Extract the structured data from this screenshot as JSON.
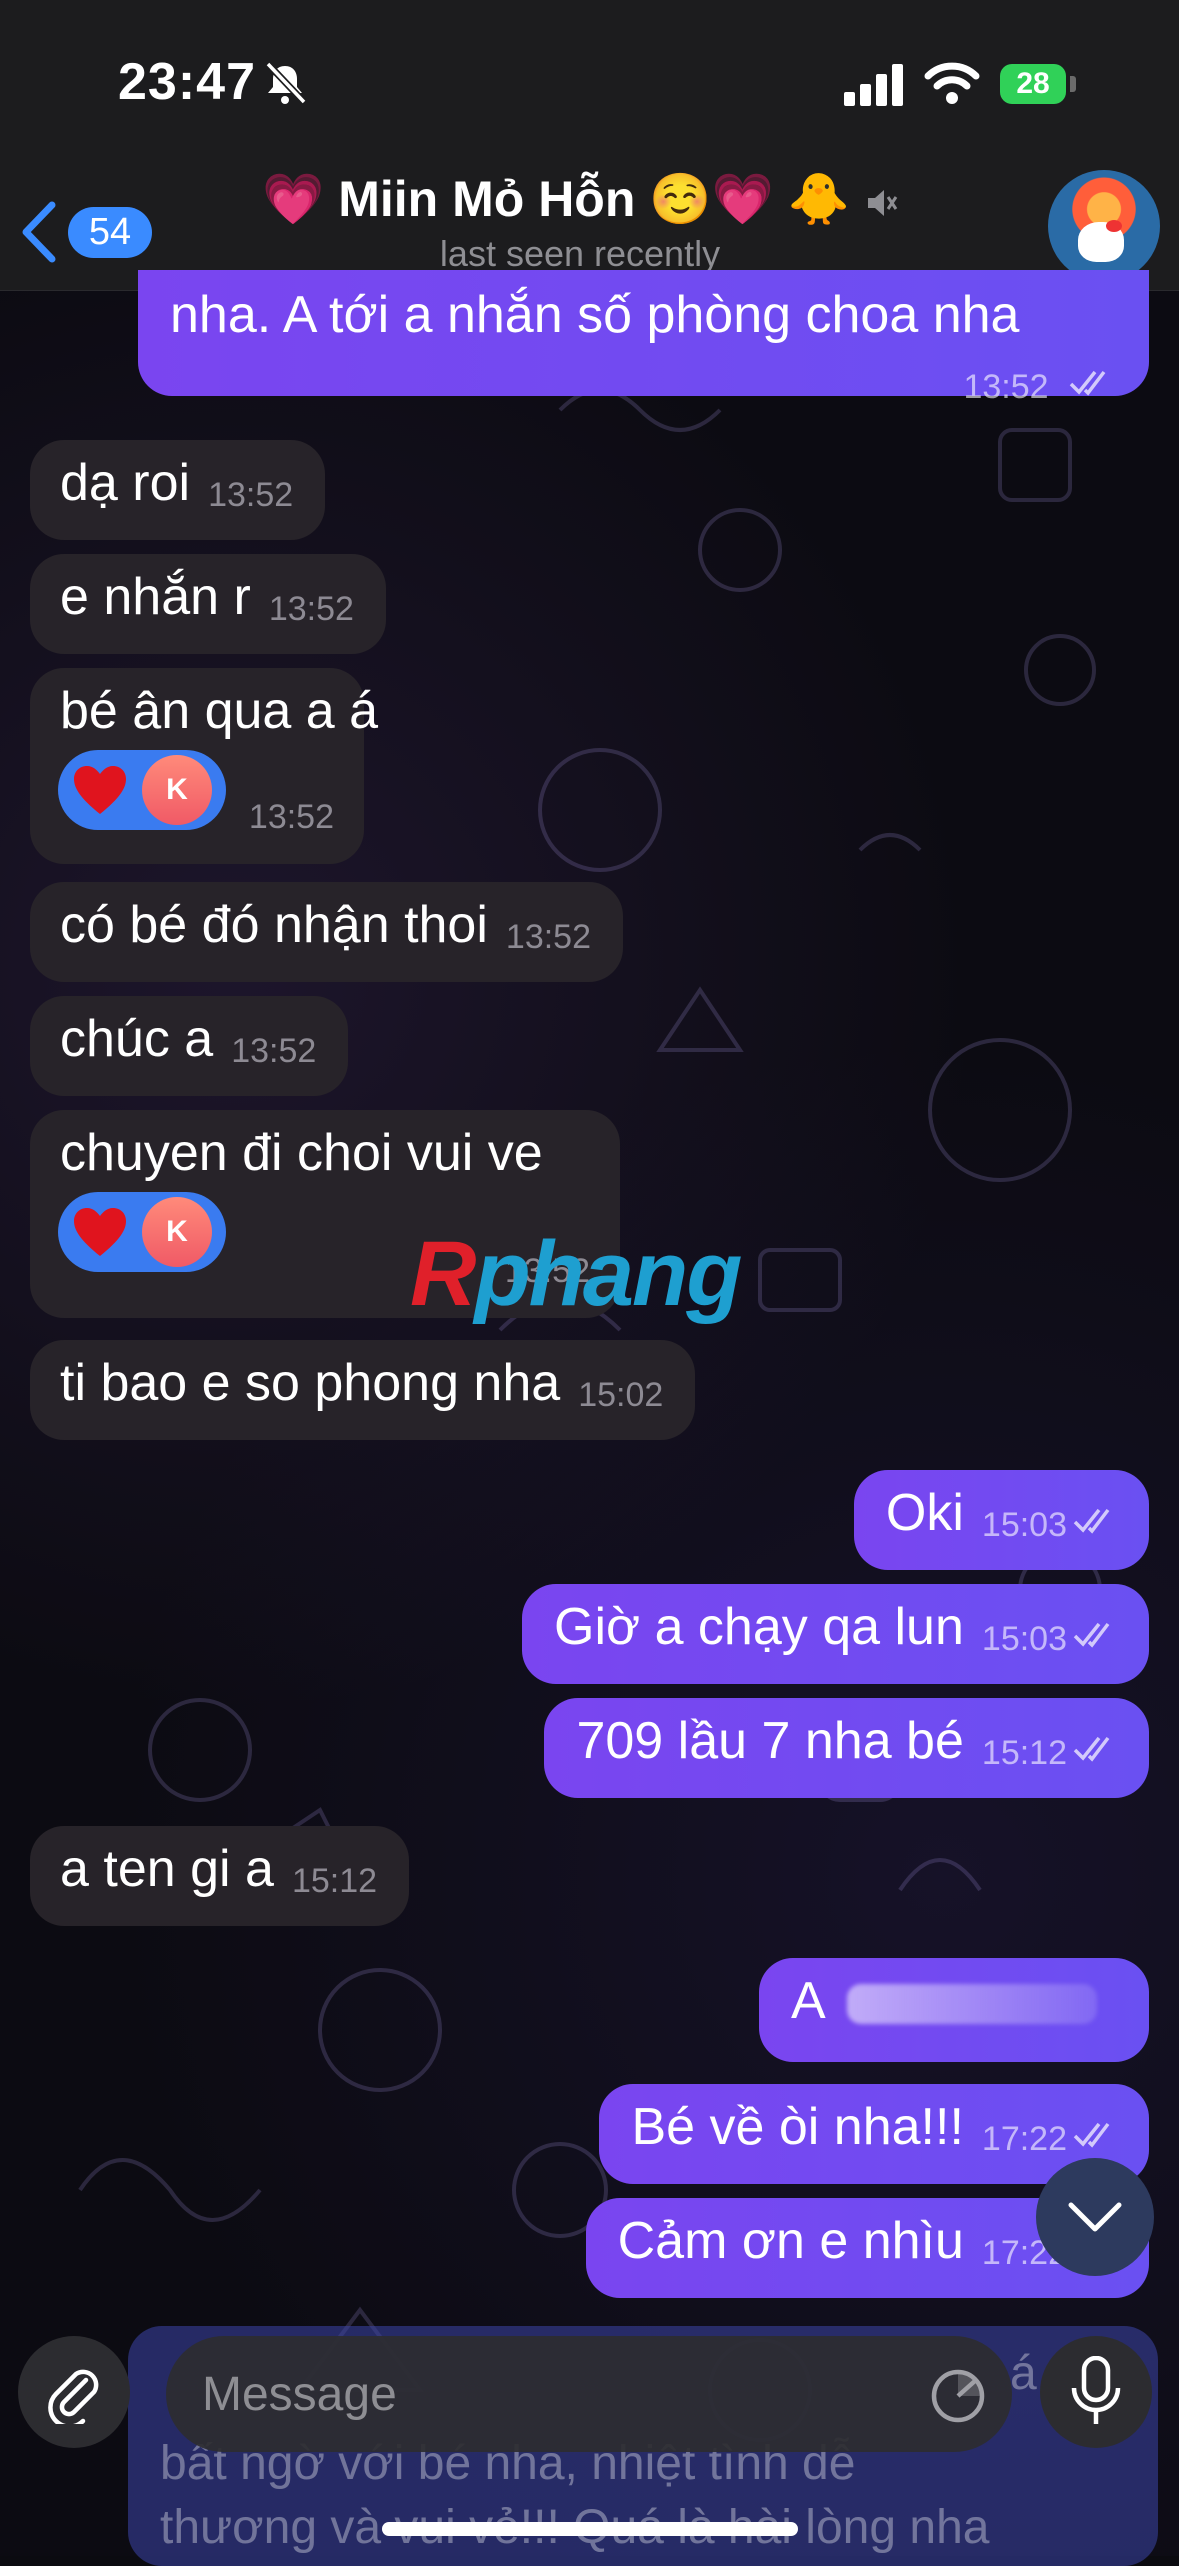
{
  "status": {
    "time": "23:47",
    "battery": "28"
  },
  "header": {
    "back_count": "54",
    "title_left_emoji": "💗",
    "title_name": "Miin Mỏ Hỗn",
    "title_right_emoji": "☺️💗",
    "title_extra_emoji": "🐥",
    "subtitle": "last seen recently"
  },
  "messages": [
    {
      "dir": "out",
      "text": "nha. A tới a nhắn số phòng choa nha",
      "time": "13:52"
    },
    {
      "dir": "in",
      "text": "dạ roi",
      "time": "13:52"
    },
    {
      "dir": "in",
      "text": "e nhắn r",
      "time": "13:52"
    },
    {
      "dir": "in",
      "text": "bé ân qua a á",
      "time": "13:52",
      "reaction": "K"
    },
    {
      "dir": "in",
      "text": "có bé đó nhận thoi",
      "time": "13:52"
    },
    {
      "dir": "in",
      "text": "chúc a",
      "time": "13:52"
    },
    {
      "dir": "in",
      "text": "chuyen đi choi vui ve",
      "time": "13:52",
      "reaction": "K"
    },
    {
      "dir": "in",
      "text": "ti bao e so phong nha",
      "time": "15:02"
    },
    {
      "dir": "out",
      "text": "Oki",
      "time": "15:03"
    },
    {
      "dir": "out",
      "text": "Giờ a chạy qa lun",
      "time": "15:03"
    },
    {
      "dir": "out",
      "text": "709 lầu 7 nha bé",
      "time": "15:12"
    },
    {
      "dir": "in",
      "text": "a ten gi a",
      "time": "15:12"
    },
    {
      "dir": "out",
      "text": "A",
      "time": ""
    },
    {
      "dir": "out",
      "text": "Bé về òi nha!!!",
      "time": "17:22"
    },
    {
      "dir": "out",
      "text": "Cảm ơn e nhìu",
      "time": "17:22"
    }
  ],
  "watermark": {
    "left": "R",
    "right": "phang"
  },
  "input": {
    "placeholder": "Message",
    "peek_line1": "bất ngờ với bé nha, nhiệt tình dễ",
    "peek_line2": "thương và vui vẻ!!! Quá là hài lòng nha",
    "peek_right": "á"
  },
  "icons": {
    "mute": "bell-slash-icon",
    "signal": "signal-icon",
    "wifi": "wifi-icon",
    "back": "chevron-left-icon",
    "reaction": "heart-icon",
    "read": "double-check-icon",
    "scroll": "chevron-down-icon",
    "attach": "paperclip-icon",
    "sticker": "sticker-icon",
    "mic": "microphone-icon"
  }
}
